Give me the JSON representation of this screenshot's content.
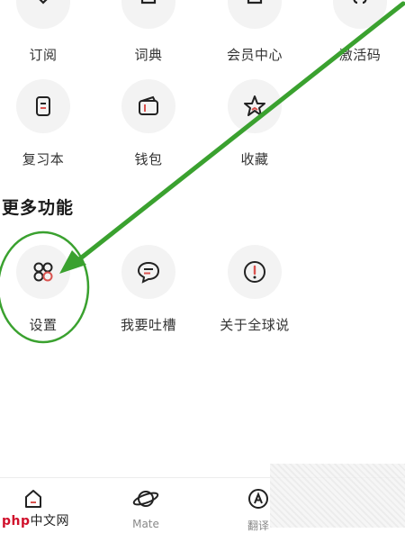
{
  "top_row": [
    {
      "label": "订阅",
      "icon": "subscribe-icon"
    },
    {
      "label": "词典",
      "icon": "dictionary-icon"
    },
    {
      "label": "会员中心",
      "icon": "membership-icon"
    },
    {
      "label": "激活码",
      "icon": "activation-code-icon"
    }
  ],
  "second_row": [
    {
      "label": "复习本",
      "icon": "review-book-icon"
    },
    {
      "label": "钱包",
      "icon": "wallet-icon"
    },
    {
      "label": "收藏",
      "icon": "star-icon"
    }
  ],
  "more": {
    "title": "更多功能",
    "items": [
      {
        "label": "设置",
        "icon": "settings-grid-icon"
      },
      {
        "label": "我要吐槽",
        "icon": "feedback-chat-icon"
      },
      {
        "label": "关于全球说",
        "icon": "info-alert-icon"
      }
    ]
  },
  "tabs": [
    {
      "label": "",
      "icon": "home-icon"
    },
    {
      "label": "Mate",
      "icon": "planet-icon"
    },
    {
      "label": "翻译",
      "icon": "translate-icon"
    }
  ],
  "watermark": {
    "brand": "php",
    "suffix": "中文网"
  },
  "annotation_color": "#3aa12f",
  "accent_color": "#d9534f"
}
